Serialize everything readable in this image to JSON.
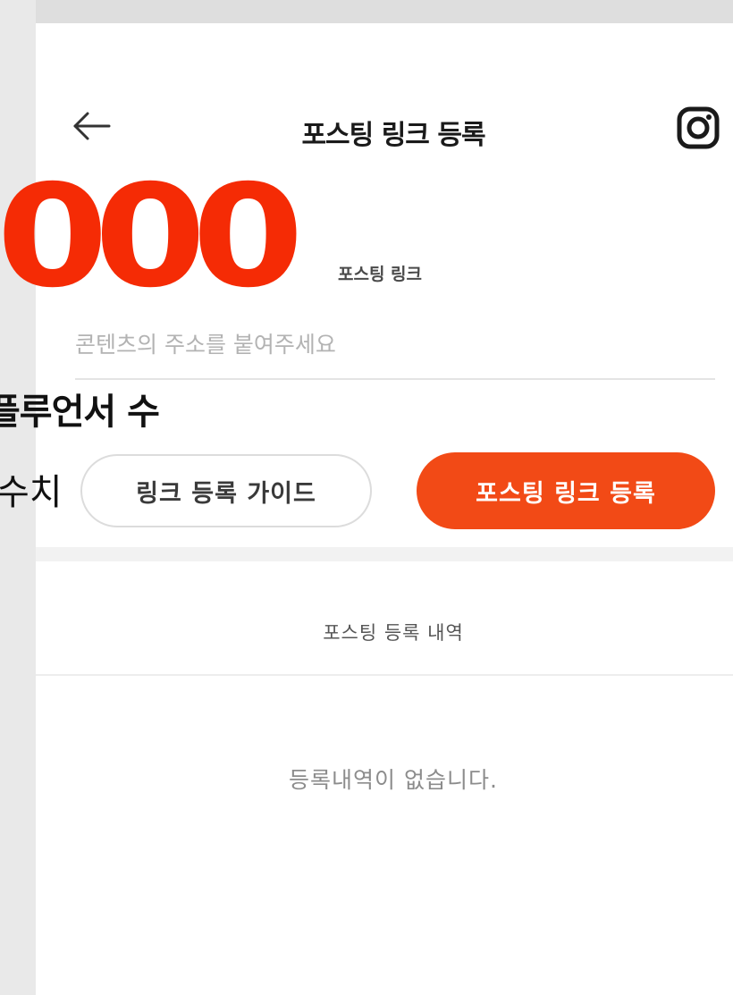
{
  "header": {
    "title": "포스팅 링크 등록",
    "back_icon": "arrow-left-icon",
    "instagram_icon": "instagram-icon"
  },
  "form": {
    "label": "포스팅 링크",
    "placeholder": "콘텐츠의 주소를 붙여주세요",
    "value": ""
  },
  "buttons": {
    "guide_label": "링크 등록 가이드",
    "submit_label": "포스팅 링크 등록"
  },
  "history": {
    "title": "포스팅 등록 내역",
    "empty_message": "등록내역이 없습니다."
  },
  "overlay": {
    "count_text": "000",
    "line1": "플루언서 수",
    "line2": "수치"
  },
  "colors": {
    "accent": "#f24a16",
    "overlay_red": "#f52b05",
    "text_dark": "#1a1a1a",
    "placeholder": "#b3b3b3"
  }
}
